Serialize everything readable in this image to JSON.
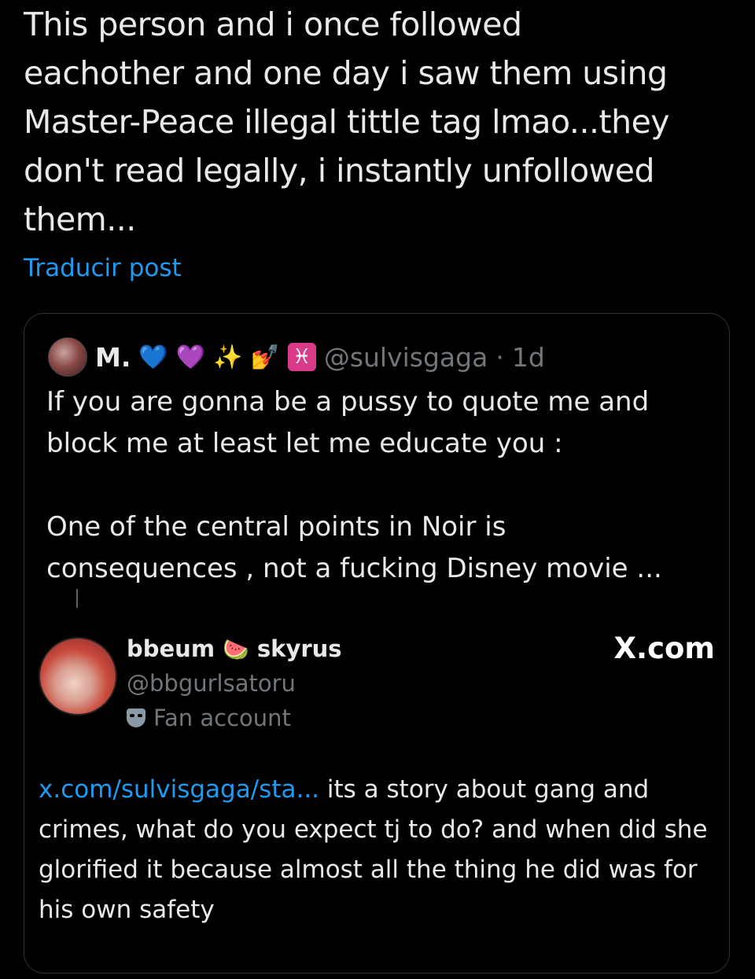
{
  "post": {
    "text": "This person and i once followed\neachother and one day i saw them using\nMaster-Peace illegal tittle tag lmao...they\ndon't read legally, i instantly unfollowed\nthem...",
    "translate_label": "Traducir post"
  },
  "quote": {
    "display_name": "M.",
    "emoji": [
      "💙",
      "💜",
      "✨",
      "💅",
      "♓"
    ],
    "handle": "@sulvisgaga",
    "separator": "·",
    "time": "1d",
    "text": "If you are gonna be a pussy to quote me and\nblock me at least let me educate you :\n\nOne of the central points in Noir is\nconsequences , not a fucking Disney movie ..."
  },
  "embedded": {
    "name_part1": "bbeum",
    "name_emoji": "🍉",
    "name_part2": "skyrus",
    "handle": "@bbgurlsatoru",
    "badge_label": "Fan account",
    "source": "X.com",
    "link_text": "x.com/sulvisgaga/sta...",
    "body_text": " its a story about gang and crimes, what do you expect tj to do? and when did she glorified it because almost all the thing he did was for his own safety"
  },
  "colors": {
    "background": "#000000",
    "text": "#e7e9ea",
    "muted": "#71767b",
    "link": "#1d9bf0",
    "border": "#2f3336"
  }
}
